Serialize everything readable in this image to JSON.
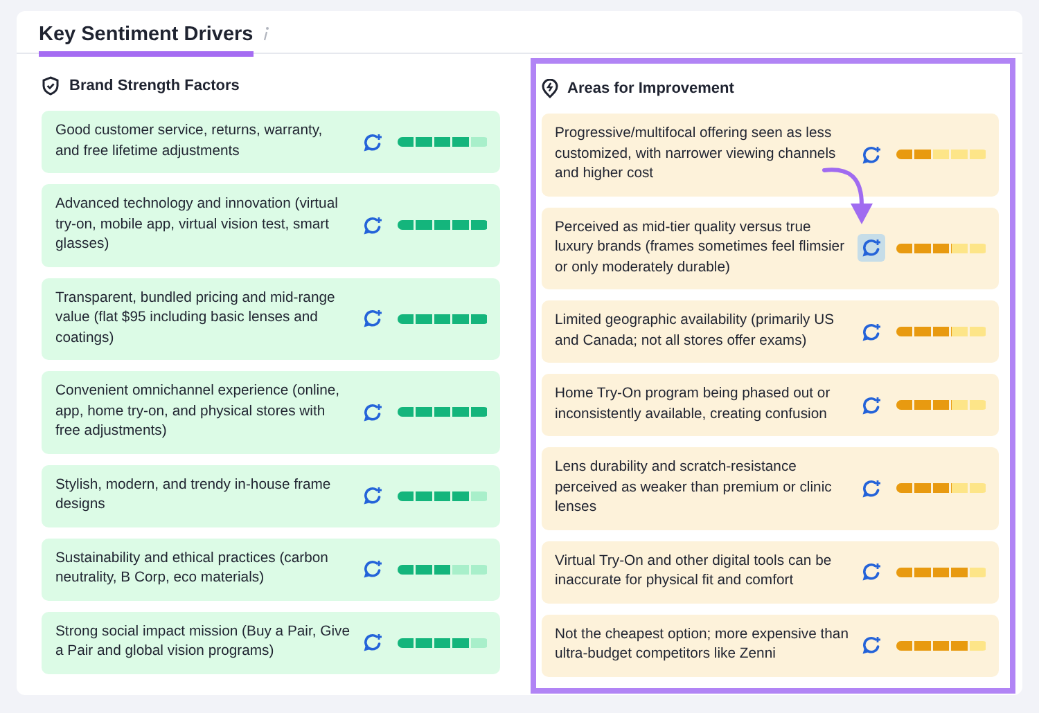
{
  "header": {
    "title": "Key Sentiment Drivers",
    "selected": true
  },
  "panels": [
    {
      "title": "Brand Strength Factors",
      "kind": "strength",
      "highlighted": false,
      "items": [
        {
          "text": "Good customer service, returns, warranty, and free lifetime adjustments",
          "level": 0.8,
          "highlighted": false
        },
        {
          "text": "Advanced technology and innovation (virtual try-on, mobile app, virtual vision test, smart glasses)",
          "level": 1,
          "highlighted": false
        },
        {
          "text": "Transparent, bundled pricing and mid-range value (flat $95 including basic lenses and coatings)",
          "level": 1,
          "highlighted": false
        },
        {
          "text": "Convenient omnichannel experience (online, app, home try-on, and physical stores with free adjustments)",
          "level": 1,
          "highlighted": false
        },
        {
          "text": "Stylish, modern, and trendy in-house frame designs",
          "level": 0.8,
          "highlighted": false
        },
        {
          "text": "Sustainability and ethical practices (carbon neutrality, B Corp, eco materials)",
          "level": 0.6,
          "highlighted": false
        },
        {
          "text": "Strong social impact mission (Buy a Pair, Give a Pair and global vision programs)",
          "level": 0.8,
          "highlighted": false
        }
      ]
    },
    {
      "title": "Areas for Improvement",
      "kind": "improvement",
      "highlighted": true,
      "items": [
        {
          "text": "Progressive/multifocal offering seen as less customized, with narrower viewing channels and higher cost",
          "level": 0.4,
          "highlighted": false
        },
        {
          "text": "Perceived as mid-tier quality versus true luxury brands (frames sometimes feel flimsier or only moderately durable)",
          "level": 0.6,
          "highlighted": true
        },
        {
          "text": "Limited geographic availability (primarily US and Canada; not all stores offer exams)",
          "level": 0.6,
          "highlighted": false
        },
        {
          "text": "Home Try-On program being phased out or inconsistently available, creating confusion",
          "level": 0.6,
          "highlighted": false
        },
        {
          "text": "Lens durability and scratch-resistance perceived as weaker than premium or clinic lenses",
          "level": 0.6,
          "highlighted": false
        },
        {
          "text": "Virtual Try-On and other digital tools can be inaccurate for physical fit and comfort",
          "level": 0.8,
          "highlighted": false
        },
        {
          "text": "Not the cheapest option; more expensive than ultra-budget competitors like Zenni",
          "level": 0.8,
          "highlighted": false
        }
      ]
    }
  ]
}
